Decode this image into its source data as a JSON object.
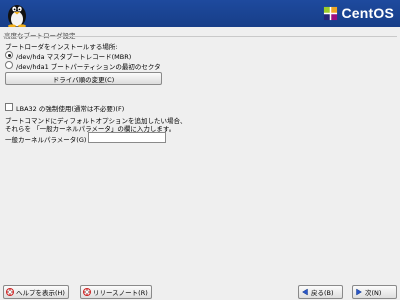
{
  "header": {
    "brand": "CentOS",
    "logo_icon": "tux-penguin-icon",
    "brand_icon": "centos-logo-icon",
    "bar_color": "#1e4a9e"
  },
  "section_title": "高度なブートローダ設定",
  "install_prompt": "ブートローダをインストールする場所:",
  "radio_options": [
    {
      "label": "/dev/hda マスタブートレコード(MBR)",
      "selected": true
    },
    {
      "label": "/dev/hda1 ブートパーティションの最初のセクタ",
      "selected": false
    }
  ],
  "change_drive_button": "ドライバ順の変更(C)",
  "lba32_checkbox": {
    "label": "LBA32 の強制使用(通常は不必要)(F)",
    "checked": false
  },
  "kernel_info": [
    "ブートコマンドにディフォルトオプションを追加したい場合、",
    "それらを 「一般カーネルパラメータ」の欄に入力します。"
  ],
  "kernel_param": {
    "label": "一般カーネルパラメータ(G)",
    "value": ""
  },
  "footer": {
    "help_button": "ヘルプを表示(H)",
    "release_notes_button": "リリースノート(R)",
    "back_button": "戻る(B)",
    "next_button": "次(N)"
  }
}
